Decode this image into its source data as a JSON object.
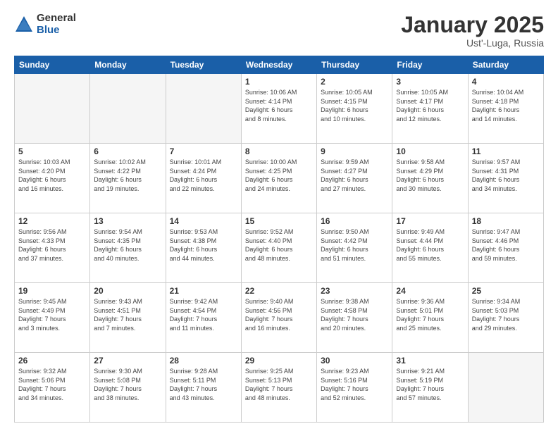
{
  "header": {
    "logo_general": "General",
    "logo_blue": "Blue",
    "title": "January 2025",
    "location": "Ust'-Luga, Russia"
  },
  "weekdays": [
    "Sunday",
    "Monday",
    "Tuesday",
    "Wednesday",
    "Thursday",
    "Friday",
    "Saturday"
  ],
  "weeks": [
    [
      {
        "day": "",
        "info": ""
      },
      {
        "day": "",
        "info": ""
      },
      {
        "day": "",
        "info": ""
      },
      {
        "day": "1",
        "info": "Sunrise: 10:06 AM\nSunset: 4:14 PM\nDaylight: 6 hours\nand 8 minutes."
      },
      {
        "day": "2",
        "info": "Sunrise: 10:05 AM\nSunset: 4:15 PM\nDaylight: 6 hours\nand 10 minutes."
      },
      {
        "day": "3",
        "info": "Sunrise: 10:05 AM\nSunset: 4:17 PM\nDaylight: 6 hours\nand 12 minutes."
      },
      {
        "day": "4",
        "info": "Sunrise: 10:04 AM\nSunset: 4:18 PM\nDaylight: 6 hours\nand 14 minutes."
      }
    ],
    [
      {
        "day": "5",
        "info": "Sunrise: 10:03 AM\nSunset: 4:20 PM\nDaylight: 6 hours\nand 16 minutes."
      },
      {
        "day": "6",
        "info": "Sunrise: 10:02 AM\nSunset: 4:22 PM\nDaylight: 6 hours\nand 19 minutes."
      },
      {
        "day": "7",
        "info": "Sunrise: 10:01 AM\nSunset: 4:24 PM\nDaylight: 6 hours\nand 22 minutes."
      },
      {
        "day": "8",
        "info": "Sunrise: 10:00 AM\nSunset: 4:25 PM\nDaylight: 6 hours\nand 24 minutes."
      },
      {
        "day": "9",
        "info": "Sunrise: 9:59 AM\nSunset: 4:27 PM\nDaylight: 6 hours\nand 27 minutes."
      },
      {
        "day": "10",
        "info": "Sunrise: 9:58 AM\nSunset: 4:29 PM\nDaylight: 6 hours\nand 30 minutes."
      },
      {
        "day": "11",
        "info": "Sunrise: 9:57 AM\nSunset: 4:31 PM\nDaylight: 6 hours\nand 34 minutes."
      }
    ],
    [
      {
        "day": "12",
        "info": "Sunrise: 9:56 AM\nSunset: 4:33 PM\nDaylight: 6 hours\nand 37 minutes."
      },
      {
        "day": "13",
        "info": "Sunrise: 9:54 AM\nSunset: 4:35 PM\nDaylight: 6 hours\nand 40 minutes."
      },
      {
        "day": "14",
        "info": "Sunrise: 9:53 AM\nSunset: 4:38 PM\nDaylight: 6 hours\nand 44 minutes."
      },
      {
        "day": "15",
        "info": "Sunrise: 9:52 AM\nSunset: 4:40 PM\nDaylight: 6 hours\nand 48 minutes."
      },
      {
        "day": "16",
        "info": "Sunrise: 9:50 AM\nSunset: 4:42 PM\nDaylight: 6 hours\nand 51 minutes."
      },
      {
        "day": "17",
        "info": "Sunrise: 9:49 AM\nSunset: 4:44 PM\nDaylight: 6 hours\nand 55 minutes."
      },
      {
        "day": "18",
        "info": "Sunrise: 9:47 AM\nSunset: 4:46 PM\nDaylight: 6 hours\nand 59 minutes."
      }
    ],
    [
      {
        "day": "19",
        "info": "Sunrise: 9:45 AM\nSunset: 4:49 PM\nDaylight: 7 hours\nand 3 minutes."
      },
      {
        "day": "20",
        "info": "Sunrise: 9:43 AM\nSunset: 4:51 PM\nDaylight: 7 hours\nand 7 minutes."
      },
      {
        "day": "21",
        "info": "Sunrise: 9:42 AM\nSunset: 4:54 PM\nDaylight: 7 hours\nand 11 minutes."
      },
      {
        "day": "22",
        "info": "Sunrise: 9:40 AM\nSunset: 4:56 PM\nDaylight: 7 hours\nand 16 minutes."
      },
      {
        "day": "23",
        "info": "Sunrise: 9:38 AM\nSunset: 4:58 PM\nDaylight: 7 hours\nand 20 minutes."
      },
      {
        "day": "24",
        "info": "Sunrise: 9:36 AM\nSunset: 5:01 PM\nDaylight: 7 hours\nand 25 minutes."
      },
      {
        "day": "25",
        "info": "Sunrise: 9:34 AM\nSunset: 5:03 PM\nDaylight: 7 hours\nand 29 minutes."
      }
    ],
    [
      {
        "day": "26",
        "info": "Sunrise: 9:32 AM\nSunset: 5:06 PM\nDaylight: 7 hours\nand 34 minutes."
      },
      {
        "day": "27",
        "info": "Sunrise: 9:30 AM\nSunset: 5:08 PM\nDaylight: 7 hours\nand 38 minutes."
      },
      {
        "day": "28",
        "info": "Sunrise: 9:28 AM\nSunset: 5:11 PM\nDaylight: 7 hours\nand 43 minutes."
      },
      {
        "day": "29",
        "info": "Sunrise: 9:25 AM\nSunset: 5:13 PM\nDaylight: 7 hours\nand 48 minutes."
      },
      {
        "day": "30",
        "info": "Sunrise: 9:23 AM\nSunset: 5:16 PM\nDaylight: 7 hours\nand 52 minutes."
      },
      {
        "day": "31",
        "info": "Sunrise: 9:21 AM\nSunset: 5:19 PM\nDaylight: 7 hours\nand 57 minutes."
      },
      {
        "day": "",
        "info": ""
      }
    ]
  ]
}
